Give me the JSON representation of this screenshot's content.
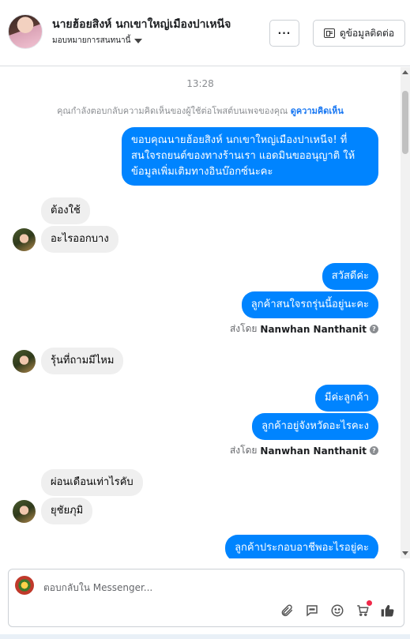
{
  "header": {
    "title": "นายฮ้อยสิงห์ นกเขาใหญ่เมืองปาเหนีจ",
    "subtitle": "มอบหมายการสนทนานี้",
    "more_label": "···",
    "contact_label": "ดูข้อมูลติดต่อ"
  },
  "conversation": {
    "timestamp": "13:28",
    "notice_text": "คุณกำลังตอบกลับความคิดเห็นของผู้ใช้ต่อโพสต์บนเพจของคุณ",
    "notice_link": "ดูความคิดเห็น",
    "messages": [
      {
        "dir": "out",
        "text": "ขอบคุณนายฮ้อยสิงห์ นกเขาใหญ่เมืองปาเหนีจ! ที่\nสนใจรถยนต์ของทางร้านเรา แอดมินขออนุญาติ ให้\nข้อมูลเพิ่มเติมทางอินบ๊อกซ์นะคะ"
      },
      {
        "dir": "in",
        "text": "ต้องใช้"
      },
      {
        "dir": "in",
        "text": "อะไรออกบาง"
      },
      {
        "dir": "out",
        "text": "สวัสดีค่ะ"
      },
      {
        "dir": "out",
        "text": "ลูกค้าสนใจรถรุ่นนี้อยู่นะคะ"
      },
      {
        "dir": "in",
        "text": "รุ้นที่ถามมีไหม"
      },
      {
        "dir": "out",
        "text": "มีค่ะลูกค้า"
      },
      {
        "dir": "out",
        "text": "ลูกค้าอยู่จังหวัดอะไรคะง"
      },
      {
        "dir": "in",
        "text": "ผ่อนเดือนเท่าไรคับ"
      },
      {
        "dir": "in",
        "text": "ยุชัยภุมิ"
      },
      {
        "dir": "out",
        "text": "ลูกค้าประกอบอาชีพอะไรอยู่คะ"
      }
    ],
    "sent_by_prefix": "ส่งโดย",
    "sent_by_name": "Nanwhan Nanthanit"
  },
  "composer": {
    "placeholder": "ตอบกลับใน Messenger..."
  },
  "icons": [
    "attach-icon",
    "saved-reply-icon",
    "emoji-icon",
    "add-to-cart-icon",
    "like-icon"
  ],
  "colors": {
    "outgoing": "#0084ff",
    "incoming": "#efefef",
    "link": "#1877f2"
  }
}
